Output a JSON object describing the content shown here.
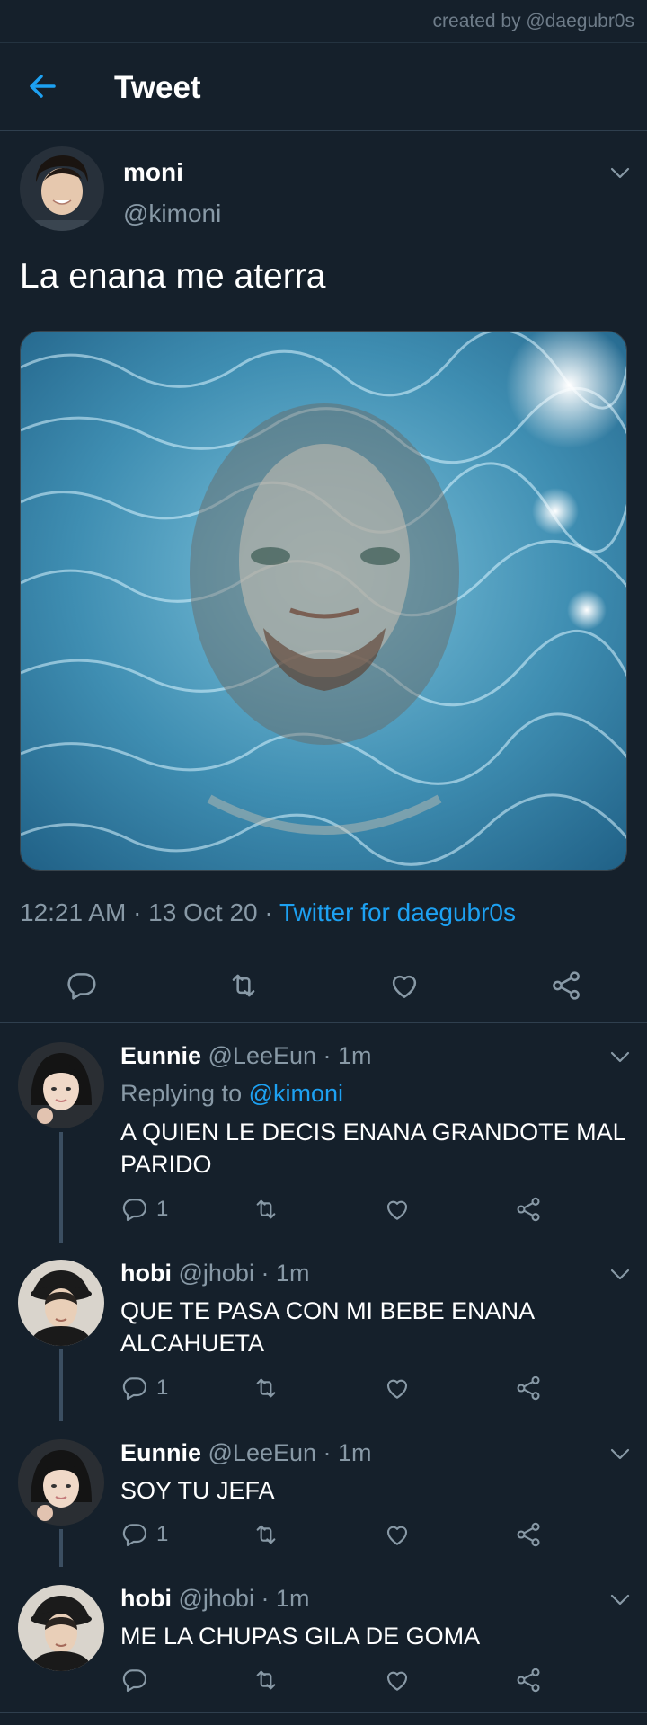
{
  "credit": "created by @daegubr0s",
  "header": {
    "title": "Tweet"
  },
  "tweet": {
    "name": "moni",
    "handle": "@kimoni",
    "text": "La enana me aterra",
    "time": "12:21 AM · 13 Oct 20 · ",
    "source": "Twitter for daegubr0s"
  },
  "replies": [
    {
      "name": "Eunnie",
      "meta": " @LeeEun · 1m",
      "replying_prefix": "Replying to ",
      "replying_to": "@kimoni",
      "text": "A QUIEN LE DECIS ENANA GRANDOTE MAL PARIDO",
      "reply_count": "1"
    },
    {
      "name": "hobi",
      "meta": " @jhobi · 1m",
      "text": "QUE TE PASA CON MI BEBE ENANA ALCAHUETA",
      "reply_count": "1"
    },
    {
      "name": "Eunnie",
      "meta": " @LeeEun · 1m",
      "text": "SOY TU JEFA",
      "reply_count": "1"
    },
    {
      "name": "hobi",
      "meta": " @jhobi · 1m",
      "text": "ME LA CHUPAS GILA DE GOMA",
      "reply_count": ""
    }
  ],
  "colors": {
    "background": "#15202b",
    "accent": "#1da1f2",
    "muted": "#8899a6"
  }
}
